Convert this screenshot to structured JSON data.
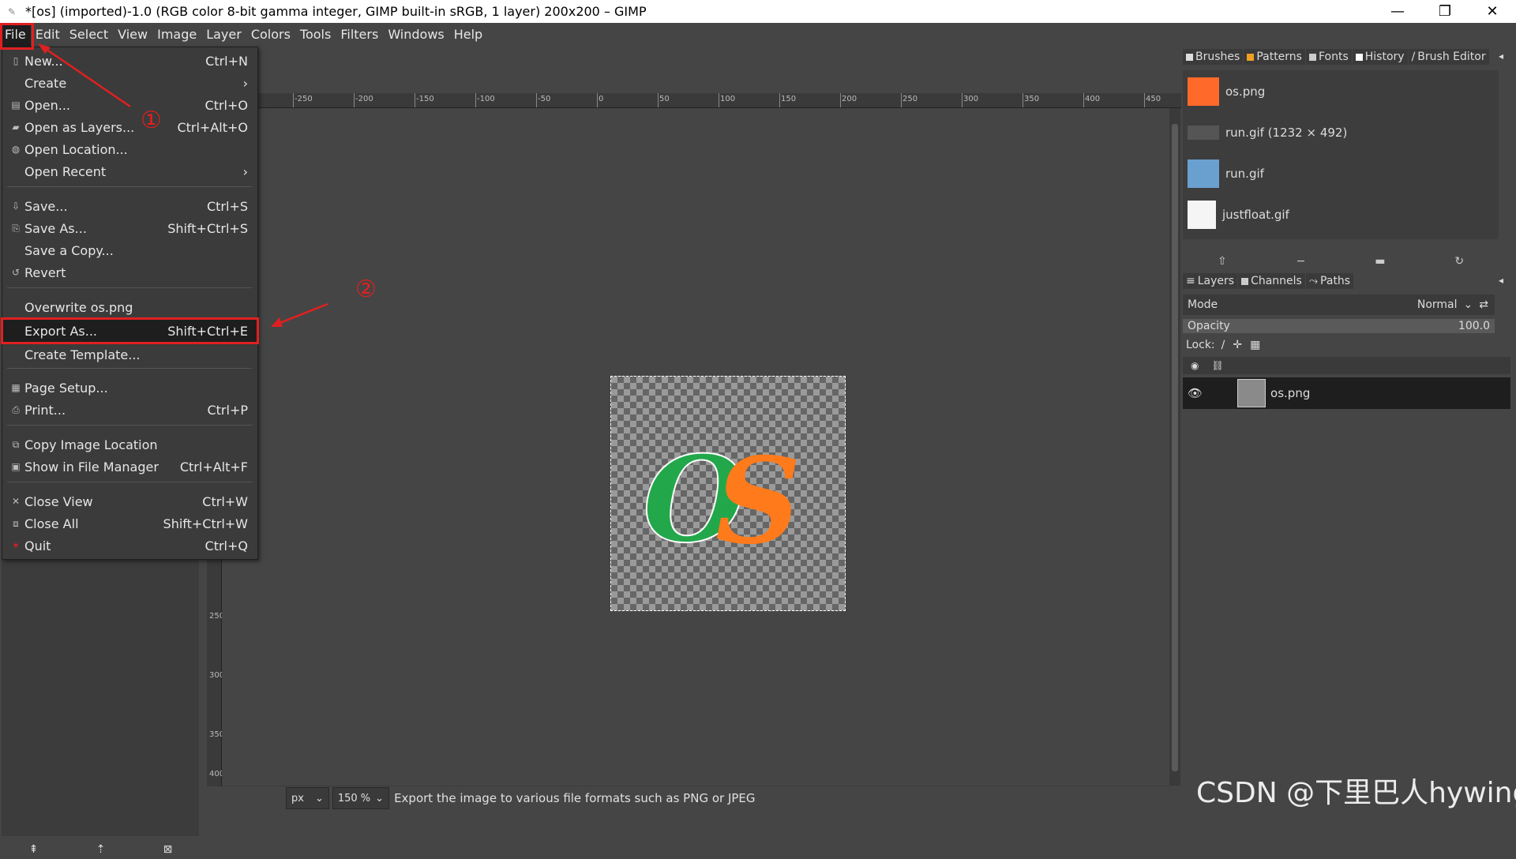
{
  "window": {
    "title": "*[os] (imported)-1.0 (RGB color 8-bit gamma integer, GIMP built-in sRGB, 1 layer) 200x200 – GIMP",
    "minimize": "—",
    "restore": "❐",
    "close": "✕"
  },
  "menubar": [
    "File",
    "Edit",
    "Select",
    "View",
    "Image",
    "Layer",
    "Colors",
    "Tools",
    "Filters",
    "Windows",
    "Help"
  ],
  "file_menu": {
    "items": [
      {
        "label": "New...",
        "shortcut": "Ctrl+N",
        "icon": "new-icon"
      },
      {
        "label": "Create",
        "shortcut": "›",
        "icon": ""
      },
      {
        "label": "Open...",
        "shortcut": "Ctrl+O",
        "icon": "open-icon"
      },
      {
        "label": "Open as Layers...",
        "shortcut": "Ctrl+Alt+O",
        "icon": "open-layers-icon"
      },
      {
        "label": "Open Location...",
        "shortcut": "",
        "icon": "globe-icon"
      },
      {
        "label": "Open Recent",
        "shortcut": "›",
        "icon": ""
      },
      {
        "label": "Save...",
        "shortcut": "Ctrl+S",
        "icon": "save-icon"
      },
      {
        "label": "Save As...",
        "shortcut": "Shift+Ctrl+S",
        "icon": "save-as-icon"
      },
      {
        "label": "Save a Copy...",
        "shortcut": "",
        "icon": ""
      },
      {
        "label": "Revert",
        "shortcut": "",
        "icon": "revert-icon"
      },
      {
        "label": "Overwrite os.png",
        "shortcut": "",
        "icon": ""
      },
      {
        "label": "Export As...",
        "shortcut": "Shift+Ctrl+E",
        "icon": ""
      },
      {
        "label": "Create Template...",
        "shortcut": "",
        "icon": ""
      },
      {
        "label": "Page Setup...",
        "shortcut": "",
        "icon": "page-setup-icon"
      },
      {
        "label": "Print...",
        "shortcut": "Ctrl+P",
        "icon": "print-icon"
      },
      {
        "label": "Copy Image Location",
        "shortcut": "",
        "icon": "copy-icon"
      },
      {
        "label": "Show in File Manager",
        "shortcut": "Ctrl+Alt+F",
        "icon": "file-manager-icon"
      },
      {
        "label": "Close View",
        "shortcut": "Ctrl+W",
        "icon": "close-icon"
      },
      {
        "label": "Close All",
        "shortcut": "Shift+Ctrl+W",
        "icon": "close-all-icon"
      },
      {
        "label": "Quit",
        "shortcut": "Ctrl+Q",
        "icon": "quit-icon"
      }
    ]
  },
  "annotations": {
    "step1": "①",
    "step2": "②"
  },
  "ruler": {
    "h_ticks": [
      "-250",
      "-200",
      "-150",
      "-100",
      "-50",
      "0",
      "50",
      "100",
      "150",
      "200",
      "250",
      "300",
      "350",
      "400",
      "450"
    ],
    "v_ticks": [
      "250",
      "300",
      "350",
      "400"
    ]
  },
  "statusbar": {
    "unit": "px",
    "zoom": "150 %",
    "message": "Export the image to various file formats such as PNG or JPEG"
  },
  "canvas_text": "OS",
  "right_dock": {
    "top_tabs": [
      "Brushes",
      "Patterns",
      "Fonts",
      "History",
      "Brush Editor"
    ],
    "images": [
      {
        "name": "os.png"
      },
      {
        "name": "run.gif (1232 × 492)"
      },
      {
        "name": "run.gif"
      },
      {
        "name": "justfloat.gif"
      }
    ],
    "bottom_tabs": [
      "Layers",
      "Channels",
      "Paths"
    ],
    "mode_label": "Mode",
    "mode_value": "Normal",
    "opacity_label": "Opacity",
    "opacity_value": "100.0",
    "opacity_fraction": 1.0,
    "lock_label": "Lock:",
    "layer_name": "os.png"
  },
  "watermark": "CSDN @下里巴人hywing",
  "colors": {
    "accent_red": "#e02020",
    "os_green": "#22a84a",
    "os_orange": "#ff7a1a"
  }
}
